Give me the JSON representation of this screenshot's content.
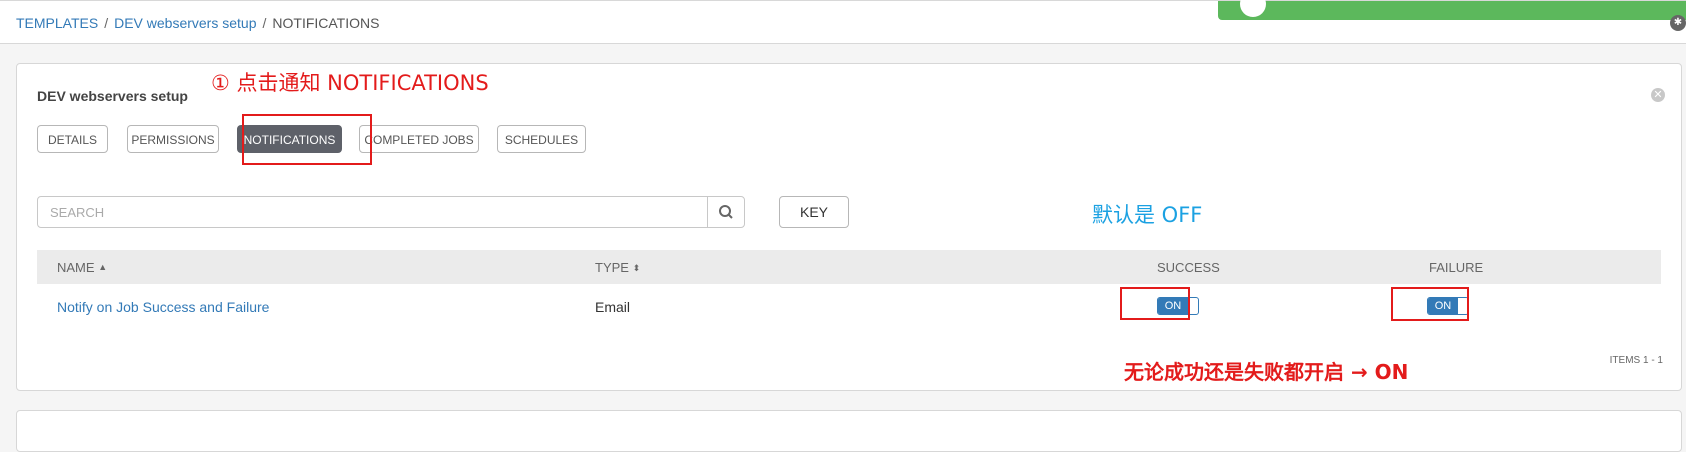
{
  "breadcrumb": {
    "items": [
      "TEMPLATES",
      "DEV webservers setup",
      "NOTIFICATIONS"
    ]
  },
  "panel": {
    "title": "DEV webservers setup",
    "tabs": [
      {
        "label": "DETAILS",
        "active": false
      },
      {
        "label": "PERMISSIONS",
        "active": false
      },
      {
        "label": "NOTIFICATIONS",
        "active": true
      },
      {
        "label": "COMPLETED JOBS",
        "active": false
      },
      {
        "label": "SCHEDULES",
        "active": false
      }
    ],
    "search": {
      "placeholder": "SEARCH",
      "value": ""
    },
    "key_label": "KEY",
    "table": {
      "headers": {
        "name": "NAME",
        "type": "TYPE",
        "success": "SUCCESS",
        "failure": "FAILURE"
      },
      "rows": [
        {
          "name": "Notify on Job Success and Failure",
          "type": "Email",
          "success": "ON",
          "failure": "ON"
        }
      ]
    },
    "items_count": "ITEMS  1 - 1"
  },
  "annotations": {
    "step1": "① 点击通知 NOTIFICATIONS",
    "default_off": "默认是 OFF",
    "both_on": "无论成功还是失败都开启 → ON"
  },
  "colors": {
    "link": "#337ab7",
    "active_tab": "#5e6169",
    "toast": "#5cb85c",
    "annotation_red": "#e31b1b",
    "annotation_blue": "#1ba1e2"
  }
}
